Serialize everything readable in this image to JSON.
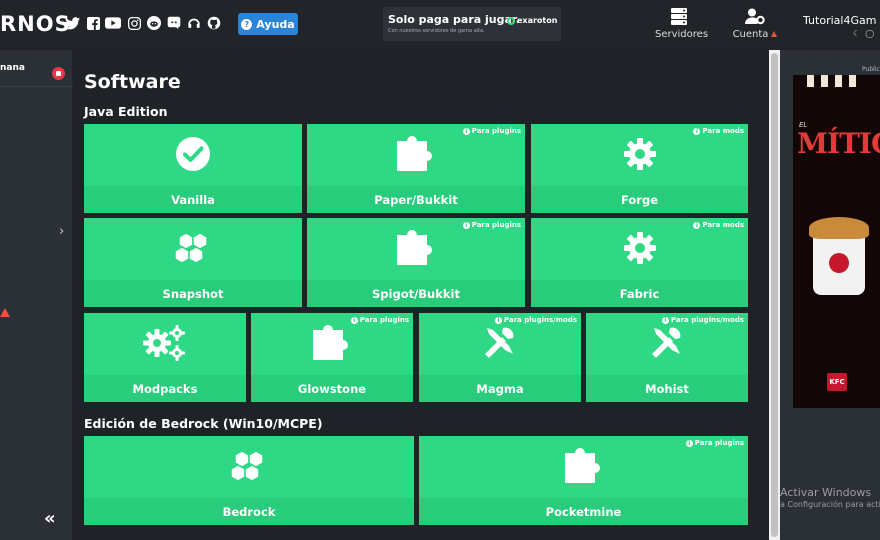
{
  "header": {
    "logo": "RNOS",
    "help_label": "Ayuda",
    "ad": {
      "title": "Solo paga para jugar.",
      "subtitle": "Con nuestros servidores de gama alta.",
      "brand": "exaroton"
    },
    "nav": {
      "servers_label": "Servidores",
      "account_label": "Cuenta"
    },
    "user": {
      "name": "Tutorial4Gam"
    },
    "social_icons": [
      "twitter-icon",
      "facebook-icon",
      "youtube-icon",
      "instagram-icon",
      "reddit-icon",
      "discord-icon",
      "teamspeak-icon",
      "github-icon"
    ]
  },
  "sidebar": {
    "item_label": "nana",
    "badge_color": "#e8374c"
  },
  "main": {
    "title": "Software",
    "java_heading": "Java Edition",
    "bedrock_heading": "Edición de Bedrock (Win10/MCPE)",
    "java_tiles": [
      {
        "label": "Vanilla",
        "tag": "",
        "icon": "check-circle-icon"
      },
      {
        "label": "Paper/Bukkit",
        "tag": "Para plugins",
        "icon": "puzzle-icon"
      },
      {
        "label": "Forge",
        "tag": "Para mods",
        "icon": "gear-icon"
      },
      {
        "label": "Snapshot",
        "tag": "",
        "icon": "cubes-icon"
      },
      {
        "label": "Spigot/Bukkit",
        "tag": "Para plugins",
        "icon": "puzzle-icon"
      },
      {
        "label": "Fabric",
        "tag": "Para mods",
        "icon": "gear-icon"
      },
      {
        "label": "Modpacks",
        "tag": "",
        "icon": "gears-icon"
      },
      {
        "label": "Glowstone",
        "tag": "Para plugins",
        "icon": "puzzle-icon"
      },
      {
        "label": "Magma",
        "tag": "Para plugins/mods",
        "icon": "tools-icon"
      },
      {
        "label": "Mohist",
        "tag": "Para plugins/mods",
        "icon": "tools-icon"
      }
    ],
    "bedrock_tiles": [
      {
        "label": "Bedrock",
        "tag": "",
        "icon": "cubes-icon"
      },
      {
        "label": "Pocketmine",
        "tag": "Para plugins",
        "icon": "puzzle-icon"
      }
    ],
    "tile_color": "#2ed884",
    "tile_label_color": "#29cc7a"
  },
  "right_panel": {
    "ad_tag": "Public",
    "ad": {
      "line1": "EL",
      "line2": "MÍTICO",
      "brand": "KFC"
    },
    "windows_activation": {
      "title": "Activar Windows",
      "subtitle": "a Configuración para acti"
    }
  }
}
